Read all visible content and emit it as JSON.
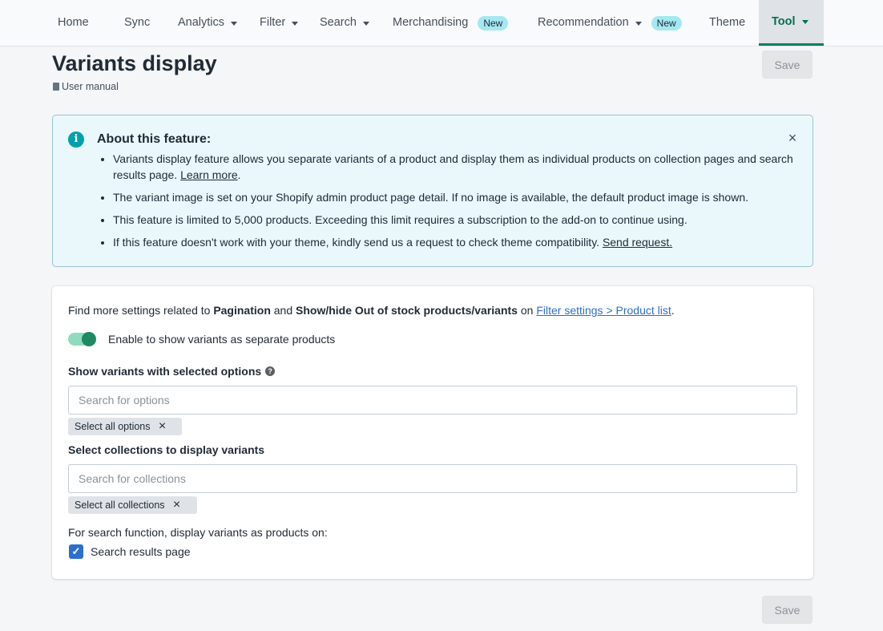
{
  "nav": {
    "items": [
      {
        "label": "Home"
      },
      {
        "label": "Sync"
      },
      {
        "label": "Analytics"
      },
      {
        "label": "Filter"
      },
      {
        "label": "Search"
      },
      {
        "label": "Merchandising",
        "badge": "New"
      },
      {
        "label": "Recommendation",
        "badge": "New"
      },
      {
        "label": "Theme"
      },
      {
        "label": "Tool"
      }
    ]
  },
  "header": {
    "title": "Variants display",
    "manual_link": "User manual",
    "save_label": "Save"
  },
  "banner": {
    "title": "About this feature:",
    "close_icon": "×",
    "bullets": [
      {
        "text": "Variants display feature allows you separate variants of a product and display them as individual products on collection pages and search results page. ",
        "link": "Learn more",
        "suffix": "."
      },
      {
        "text": "The variant image is set on your Shopify admin product page detail. If no image is available, the default product image is shown."
      },
      {
        "text": "This feature is limited to 5,000 products. Exceeding this limit requires a subscription to the add-on to continue using."
      },
      {
        "text": "If this feature doesn't work with your theme, kindly send us a request to check theme compatibility. ",
        "link": "Send request."
      }
    ]
  },
  "card": {
    "find_prefix": "Find more settings related to ",
    "find_bold1": "Pagination",
    "find_and": " and ",
    "find_bold2": "Show/hide Out of stock products/variants",
    "find_on": " on ",
    "find_link": "Filter settings > Product list",
    "find_suffix": ".",
    "toggle_label": "Enable to show variants as separate products",
    "toggle_on": true,
    "options_label": "Show variants with selected options",
    "options_placeholder": "Search for options",
    "options_tag": "Select all options",
    "collections_label": "Select collections to display variants",
    "collections_placeholder": "Search for collections",
    "collections_tag": "Select all collections",
    "search_note": "For search function, display variants as products on:",
    "search_results_label": "Search results page",
    "search_results_checked": true
  },
  "footer": {
    "save_label": "Save"
  },
  "colors": {
    "accent_green": "#008060",
    "link_blue": "#2c6ecb",
    "banner_bg": "#eaf8fb",
    "badge_bg": "#a4e8f2"
  }
}
